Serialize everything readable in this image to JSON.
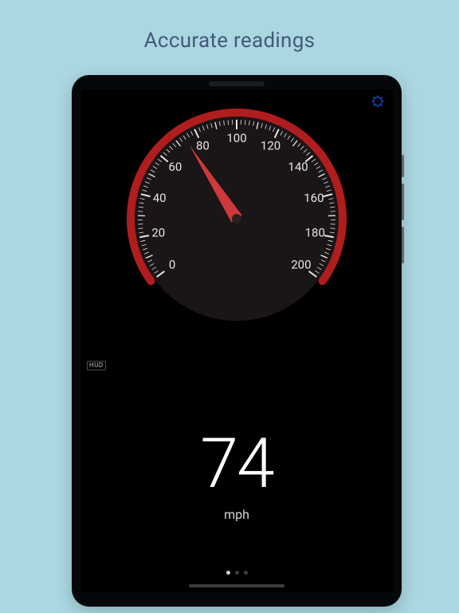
{
  "headline": "Accurate readings",
  "gauge": {
    "min": 0,
    "max": 200,
    "ticks": [
      0,
      20,
      40,
      60,
      80,
      100,
      120,
      140,
      160,
      180,
      200
    ],
    "value": 74,
    "start_deg": 216,
    "sweep_deg": 252
  },
  "hud_label": "HUD",
  "readout": {
    "speed": "74",
    "unit": "mph"
  },
  "pager": {
    "count": 3,
    "active": 0
  },
  "colors": {
    "bg": "#abd7e1",
    "headline": "#43597a",
    "rim": "#b01d1f",
    "dial_face": "#1a1516",
    "needle": "#d83b3d",
    "tick": "#e5e6e7",
    "settings": "#1d4ed8"
  }
}
